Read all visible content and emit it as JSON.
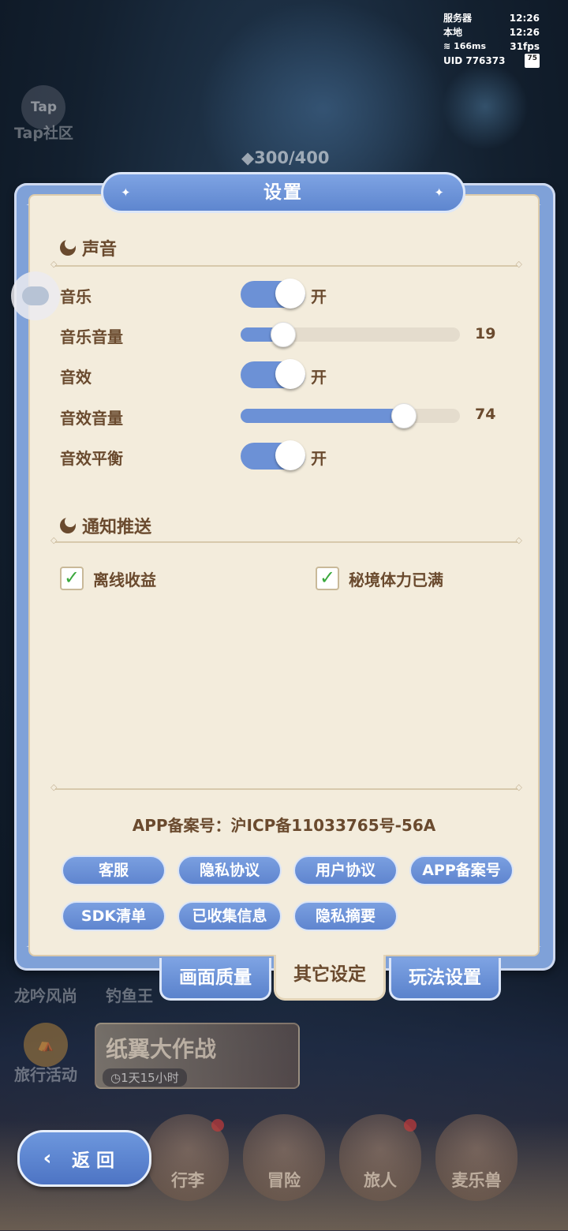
{
  "hud": {
    "server_label": "服务器",
    "server_time": "12:26",
    "local_label": "本地",
    "local_time": "12:26",
    "ping": "166ms",
    "fps": "31fps",
    "uid": "UID 776373",
    "battery": "75"
  },
  "background": {
    "tap_community": "Tap社区",
    "stamina": "300/400",
    "left_buttons": [
      "龙吟风尚",
      "钓鱼王"
    ],
    "activity": "旅行活动",
    "event_title": "纸翼大作战",
    "event_time": "1天15小时",
    "nav": [
      "行李",
      "冒险",
      "旅人",
      "麦乐兽"
    ]
  },
  "dialog": {
    "title": "设置",
    "sound": {
      "heading": "声音",
      "rows": {
        "music_label": "音乐",
        "music_state": "开",
        "music_volume_label": "音乐音量",
        "music_volume": 19,
        "sfx_label": "音效",
        "sfx_state": "开",
        "sfx_volume_label": "音效音量",
        "sfx_volume": 74,
        "sfx_balance_label": "音效平衡",
        "sfx_balance_state": "开"
      }
    },
    "push": {
      "heading": "通知推送",
      "offline_income": "离线收益",
      "stamina_full": "秘境体力已满"
    },
    "record_text": "APP备案号：沪ICP备11033765号-56A",
    "buttons": [
      "客服",
      "隐私协议",
      "用户协议",
      "APP备案号",
      "SDK清单",
      "已收集信息",
      "隐私摘要"
    ],
    "tabs": {
      "quality": "画面质量",
      "other": "其它设定",
      "gameplay": "玩法设置"
    }
  },
  "back_button": "返 回",
  "colors": {
    "accent": "#6c91d6",
    "panel": "#f3ecdc",
    "text": "#6a4a2e",
    "check": "#3aa83c"
  }
}
